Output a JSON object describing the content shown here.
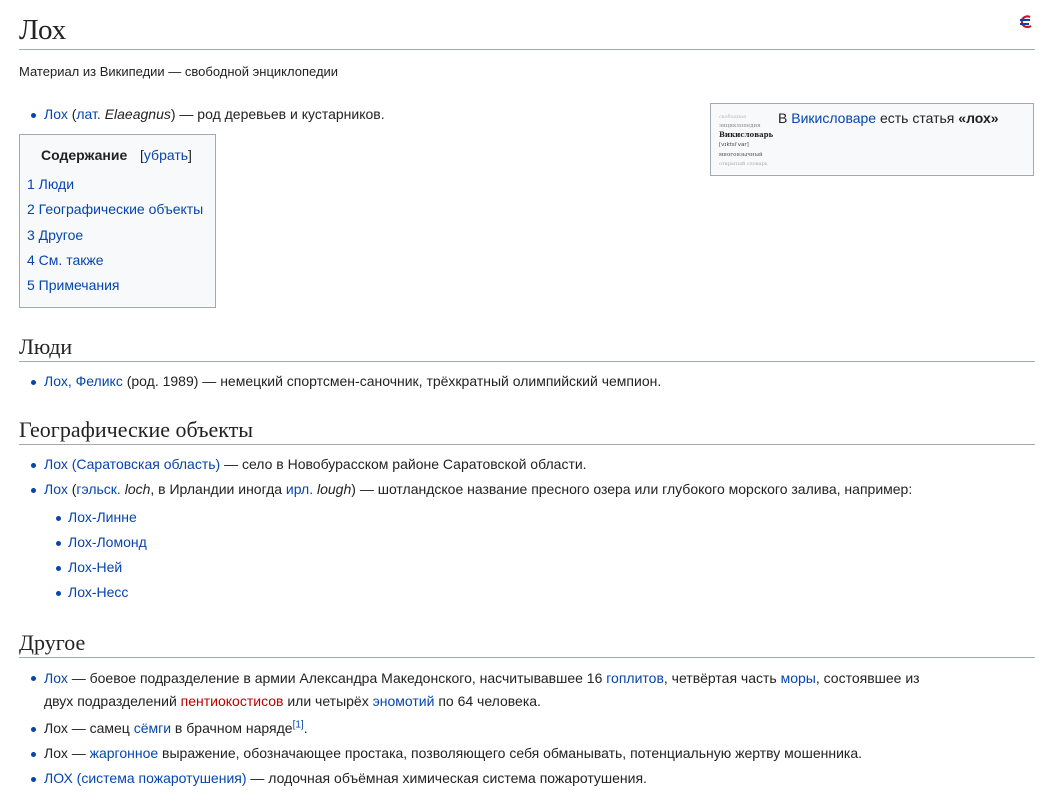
{
  "title": "Лох",
  "subtitle": "Материал из Википедии — свободной энциклопедии",
  "intro": {
    "link": "Лох",
    "lang_link": "лат.",
    "latin": "Elaeagnus",
    "rest": " — род деревьев и кустарников."
  },
  "toc": {
    "title": "Содержание",
    "toggle": "убрать",
    "items": [
      "1 Люди",
      "2 Географические объекты",
      "3 Другое",
      "4 См. также",
      "5 Примечания"
    ]
  },
  "wiktionary": {
    "prefix": "В ",
    "link": "Викисловаре",
    "middle": " есть статья ",
    "term": "«лох»",
    "logo_lines": [
      "Викисловарь",
      "[vɪktsiˈvar]",
      "многоязычный",
      "открытый словарь"
    ]
  },
  "sections": {
    "people": {
      "heading": "Люди",
      "item1": {
        "link": "Лох, Феликс",
        "rest": " (род. 1989) — немецкий спортсмен-саночник, трёхкратный олимпийский чемпион."
      }
    },
    "geo": {
      "heading": "Географические объекты",
      "item1": {
        "link": "Лох (Саратовская область)",
        "rest": " — село в Новобурасском районе Саратовской области."
      },
      "item2": {
        "link": "Лох",
        "p1": " (",
        "gael_link": "гэльск.",
        "gael_word": "loch",
        "p2": ", в Ирландии иногда ",
        "irl_link": "ирл.",
        "irl_word": "lough",
        "p3": ") — шотландское название пресного озера или глубокого морского залива, например:"
      },
      "lochs": [
        "Лох-Линне",
        "Лох-Ломонд",
        "Лох-Ней",
        "Лох-Несс"
      ]
    },
    "other": {
      "heading": "Другое",
      "item1": {
        "link": "Лох",
        "t1": " — боевое подразделение в армии Александра Македонского, насчитывавшее 16 ",
        "hoplites": "гоплитов",
        "t2": ", четвёртая часть ",
        "mora": "моры",
        "t3": ", состоявшее из",
        "t4": "двух подразделений ",
        "pentiko": "пентиокостисов",
        "t5": " или четырёх ",
        "enomoty": "эномотий",
        "t6": " по 64 человека."
      },
      "item2": {
        "t1": "Лох — самец ",
        "link": "сёмги",
        "t2": " в брачном наряде",
        "ref": "[1]",
        "t3": "."
      },
      "item3": {
        "t1": "Лох — ",
        "link": "жаргонное",
        "t2": " выражение, обозначающее простака, позволяющего себя обманывать, потенциальную жертву мошенника."
      },
      "item4": {
        "link": "ЛОХ (система пожаротушения)",
        "rest": " — лодочная объёмная химическая система пожаротушения."
      }
    }
  }
}
